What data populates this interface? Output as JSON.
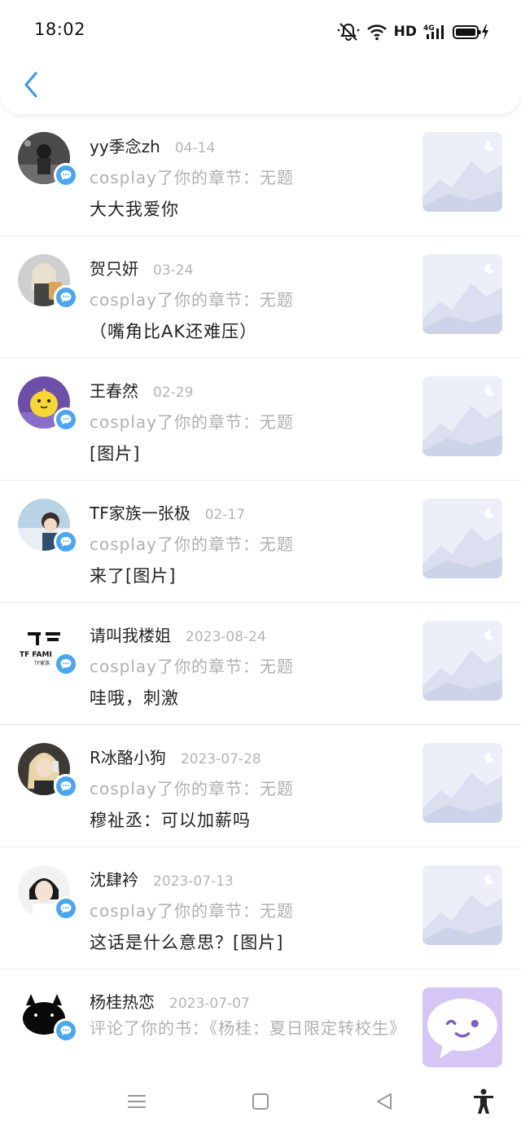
{
  "status_bar": {
    "time": "18:02",
    "network_label": "HD",
    "signal_label": "4G"
  },
  "messages": [
    {
      "name": "yy季念zh",
      "date": "04-14",
      "context": "cosplay了你的章节：无题",
      "text": "大大我爱你"
    },
    {
      "name": "贺只妍",
      "date": "03-24",
      "context": "cosplay了你的章节：无题",
      "text": "（嘴角比AK还难压）"
    },
    {
      "name": "王春然",
      "date": "02-29",
      "context": "cosplay了你的章节：无题",
      "text": "[图片]"
    },
    {
      "name": "TF家族一张极",
      "date": "02-17",
      "context": "cosplay了你的章节：无题",
      "text": "来了[图片]"
    },
    {
      "name": "请叫我楼姐",
      "date": "2023-08-24",
      "context": "cosplay了你的章节：无题",
      "text": "哇哦，刺激",
      "logo_text": "TF FAMI",
      "logo_sub": "TF家族"
    },
    {
      "name": "R冰酪小狗",
      "date": "2023-07-28",
      "context": "cosplay了你的章节：无题",
      "text": "穆祉丞：可以加薪吗"
    },
    {
      "name": "沈肆衿",
      "date": "2023-07-13",
      "context": "cosplay了你的章节：无题",
      "text": "这话是什么意思？[图片]"
    },
    {
      "name": "杨桂热恋",
      "date": "2023-07-07",
      "context": "评论了你的书：《杨桂：夏日限定转校生》",
      "text": ""
    }
  ],
  "colors": {
    "accent": "#3a9be8",
    "badge": "#4aa6ef",
    "muted": "#b0b0b0",
    "chat_thumb": "#d6c6f6"
  }
}
